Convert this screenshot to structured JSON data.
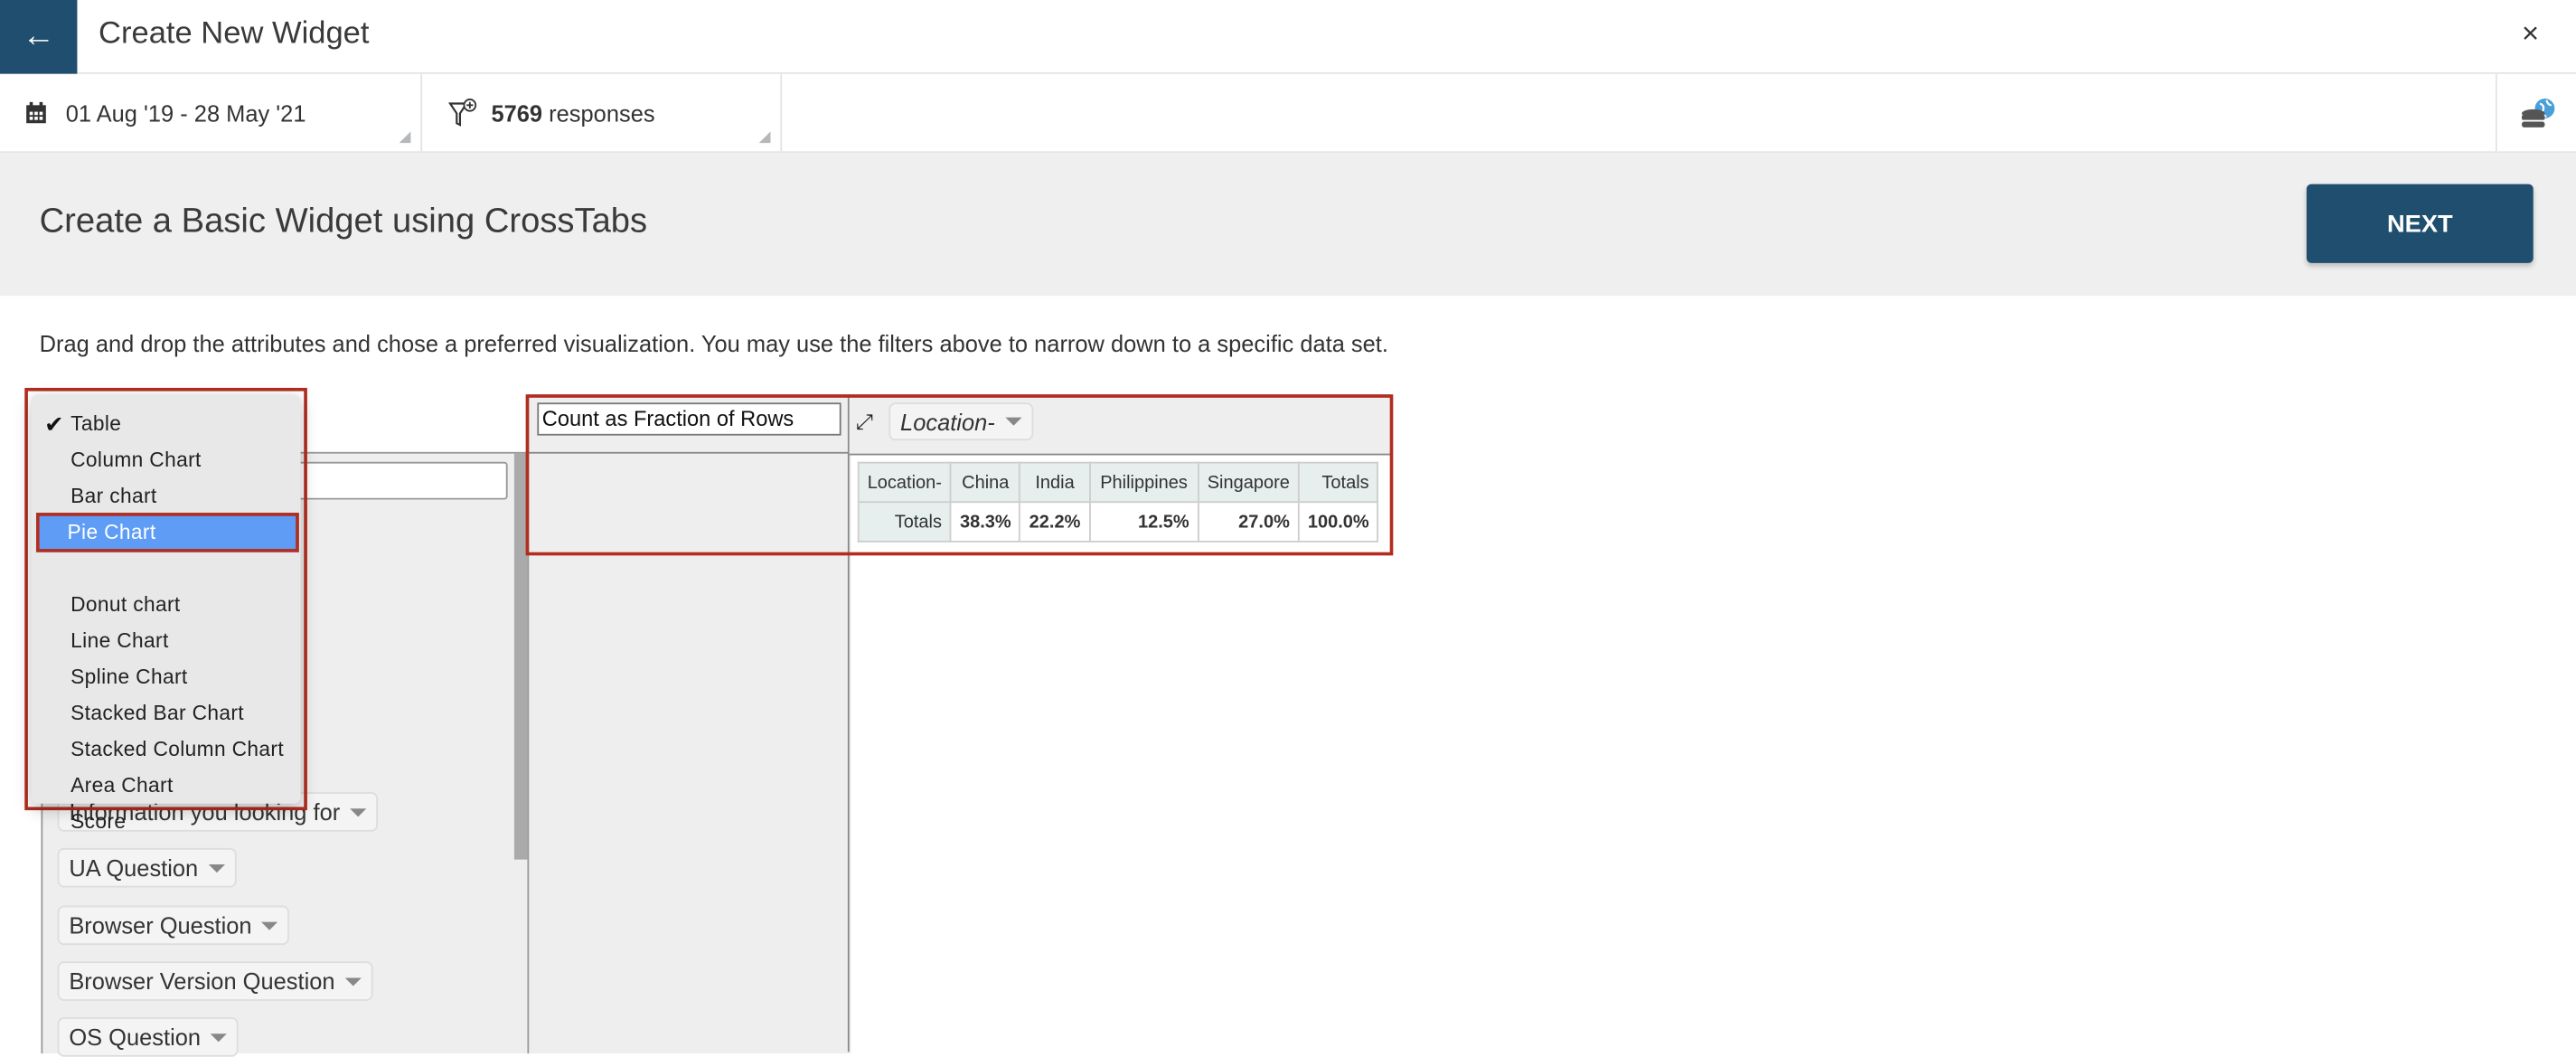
{
  "header": {
    "title": "Create New Widget",
    "back_icon": "arrow-left-icon",
    "close_icon": "close-icon",
    "close_label": "×"
  },
  "filters": {
    "date_range": "01 Aug '19 - 28 May '21",
    "responses_count": "5769",
    "responses_label": "responses",
    "data_source_icon": "database-globe-icon"
  },
  "band": {
    "title": "Create a Basic Widget using CrossTabs",
    "next_label": "NEXT"
  },
  "instructions": "Drag and drop the attributes and chose a preferred visualization. You may use the filters above to narrow down to a specific data set.",
  "visualization_menu": {
    "selected": "Table",
    "highlighted": "Pie Chart",
    "items": [
      "Table",
      "Column Chart",
      "Bar chart",
      "Pie Chart",
      "Donut chart",
      "Line Chart",
      "Spline Chart",
      "Stacked Bar Chart",
      "Stacked Column Chart",
      "Area Chart",
      "Score"
    ]
  },
  "attributes": [
    "Information you looking for",
    "UA Question",
    "Browser Question",
    "Browser Version Question",
    "OS Question"
  ],
  "aggregator": "Count as Fraction of Rows",
  "column_attribute": "Location-",
  "pivot_table": {
    "headers": [
      "Location-",
      "China",
      "India",
      "Philippines",
      "Singapore",
      "Totals"
    ],
    "rows": [
      {
        "label": "Totals",
        "values": [
          "38.3%",
          "22.2%",
          "12.5%",
          "27.0%",
          "100.0%"
        ]
      }
    ]
  },
  "colors": {
    "primary": "#1f4e6e",
    "highlight": "#5f9cf5",
    "annotation": "#b22d1f"
  }
}
